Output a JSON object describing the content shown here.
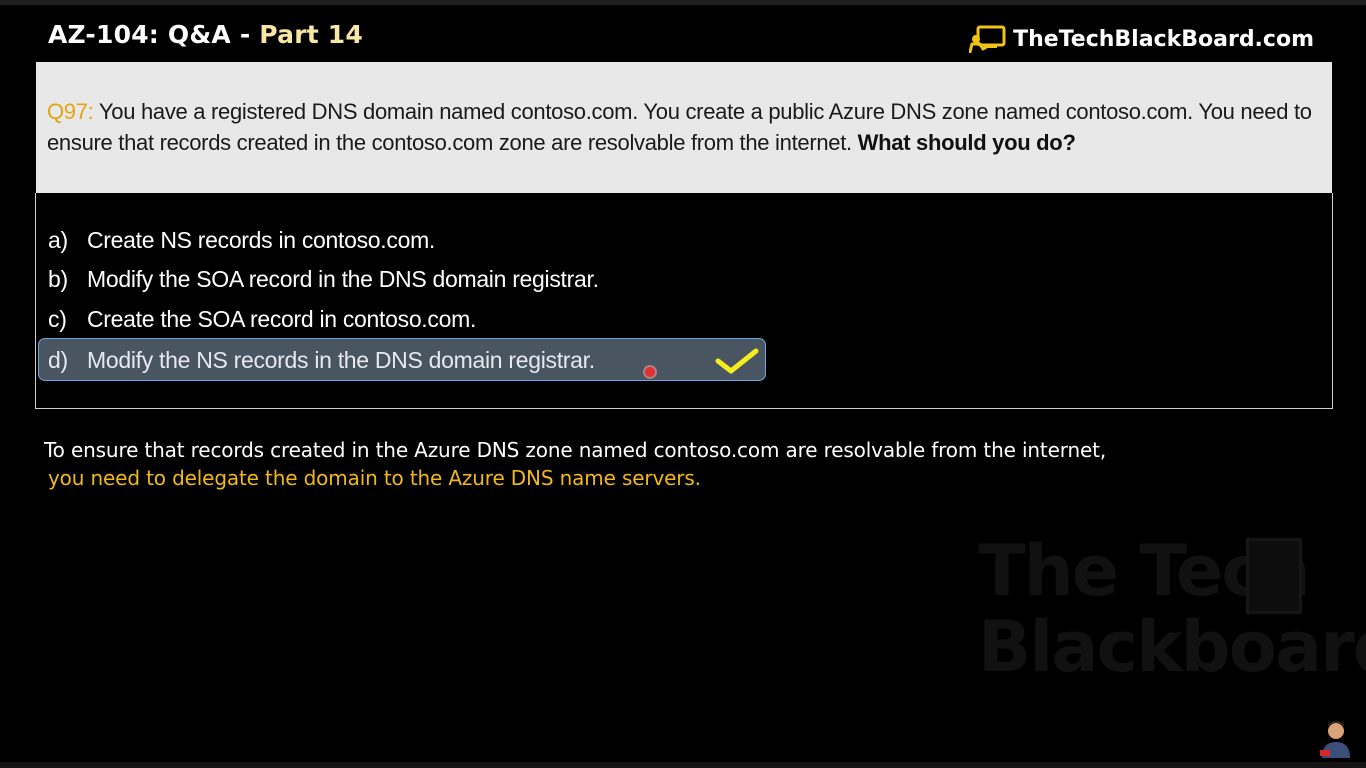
{
  "header": {
    "title_main": "AZ-104: Q&A",
    "title_sep": "-",
    "title_part": "Part 14",
    "brand_text": "TheTechBlackBoard.com",
    "brand_icon": "blackboard-teacher-icon"
  },
  "question": {
    "number": "Q97:",
    "text": "You have a registered DNS domain named contoso.com. You create a public Azure DNS zone named contoso.com. You need to ensure that records created in the contoso.com zone are resolvable from the internet.",
    "emphasis": "What should you do?"
  },
  "options": [
    {
      "letter": "a)",
      "text": "Create NS records in contoso.com."
    },
    {
      "letter": "b)",
      "text": "Modify the SOA record in the DNS domain registrar."
    },
    {
      "letter": "c)",
      "text": "Create the SOA record in contoso.com."
    },
    {
      "letter": "d)",
      "text": "Modify the NS records in the DNS domain registrar.",
      "correct": true
    }
  ],
  "explanation": {
    "line1": "To ensure that records created in the Azure DNS zone named contoso.com are resolvable from the internet,",
    "line2": "you need to delegate the domain to the Azure DNS name servers."
  },
  "watermark": {
    "line1": "The Tech",
    "line2": "Blackboard"
  },
  "colors": {
    "question_number": "#e2a412",
    "title_part": "#f8e7a2",
    "explanation_highlight": "#f2b81b",
    "check": "#f5ee1e",
    "selected_option_bg": "#4a5562",
    "selected_option_border": "#6aa6e0"
  }
}
